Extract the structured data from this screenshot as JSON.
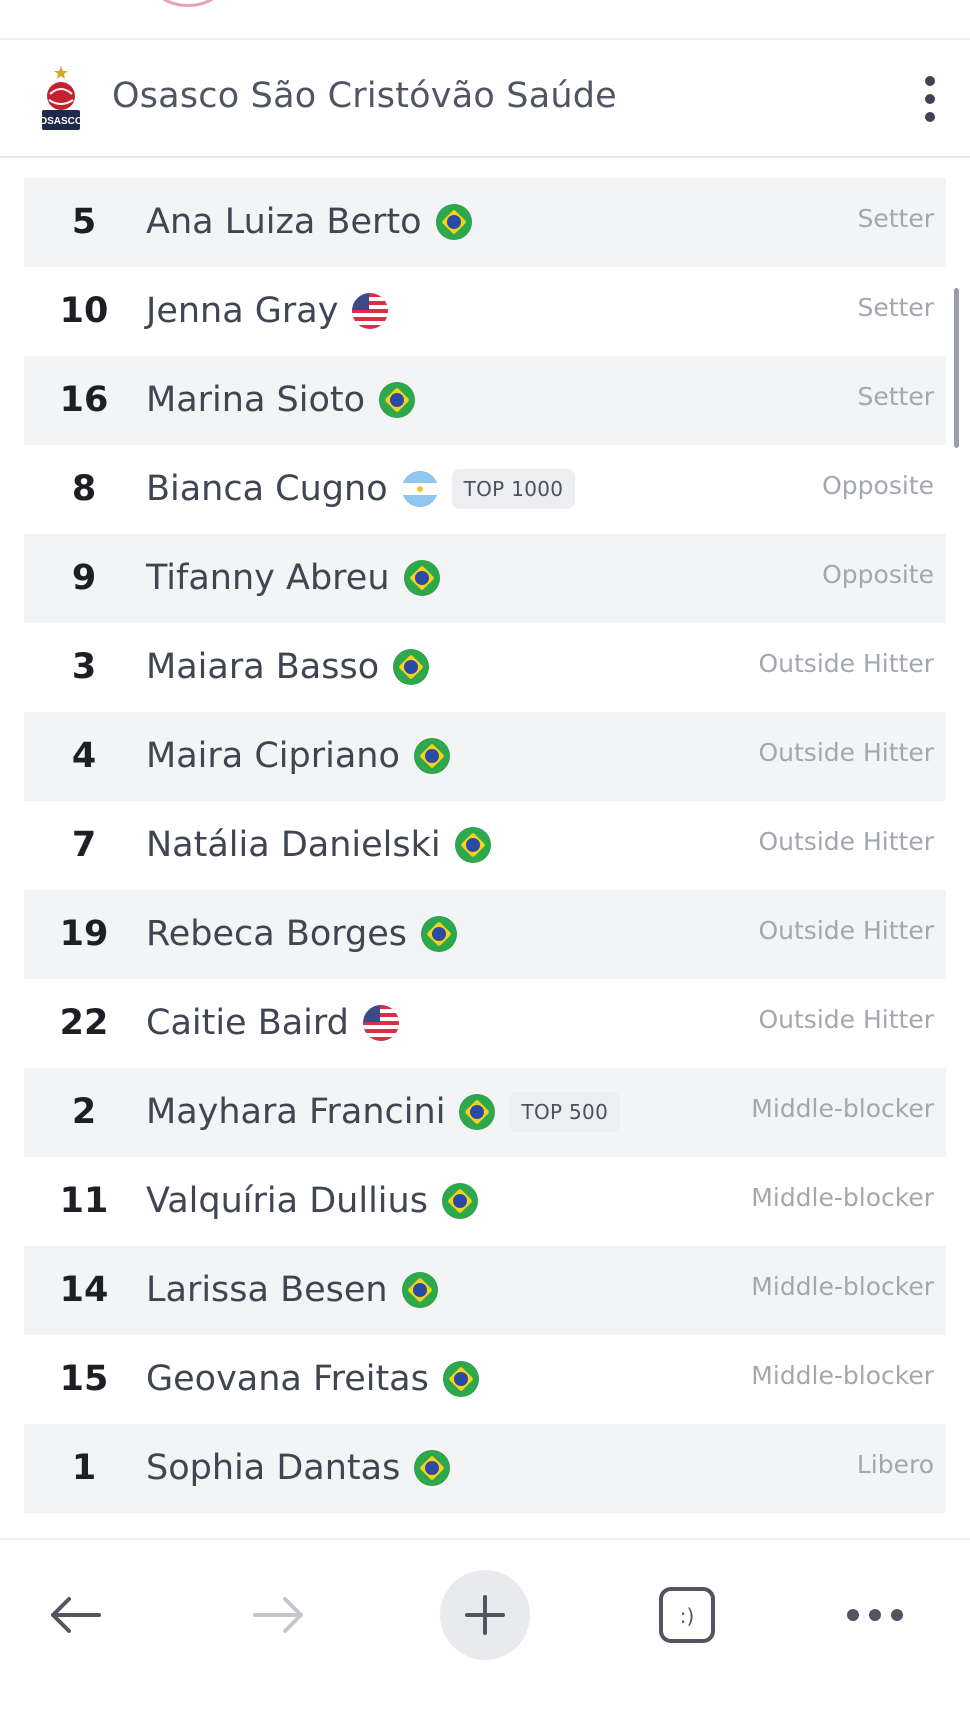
{
  "header": {
    "team_name": "Osasco São Cristóvão Saúde",
    "logo_text": "OSASCO"
  },
  "roster": [
    {
      "number": "5",
      "name": "Ana Luiza Berto",
      "flag": "br",
      "badge": "",
      "position": "Setter"
    },
    {
      "number": "10",
      "name": "Jenna Gray",
      "flag": "us",
      "badge": "",
      "position": "Setter"
    },
    {
      "number": "16",
      "name": "Marina Sioto",
      "flag": "br",
      "badge": "",
      "position": "Setter"
    },
    {
      "number": "8",
      "name": "Bianca Cugno",
      "flag": "ar",
      "badge": "TOP 1000",
      "position": "Opposite"
    },
    {
      "number": "9",
      "name": "Tifanny Abreu",
      "flag": "br",
      "badge": "",
      "position": "Opposite"
    },
    {
      "number": "3",
      "name": "Maiara Basso",
      "flag": "br",
      "badge": "",
      "position": "Outside Hitter"
    },
    {
      "number": "4",
      "name": "Maira Cipriano",
      "flag": "br",
      "badge": "",
      "position": "Outside Hitter"
    },
    {
      "number": "7",
      "name": "Natália Danielski",
      "flag": "br",
      "badge": "",
      "position": "Outside Hitter"
    },
    {
      "number": "19",
      "name": "Rebeca Borges",
      "flag": "br",
      "badge": "",
      "position": "Outside Hitter"
    },
    {
      "number": "22",
      "name": "Caitie Baird",
      "flag": "us",
      "badge": "",
      "position": "Outside Hitter"
    },
    {
      "number": "2",
      "name": "Mayhara Francini",
      "flag": "br",
      "badge": "TOP 500",
      "position": "Middle-blocker"
    },
    {
      "number": "11",
      "name": "Valquíria Dullius",
      "flag": "br",
      "badge": "",
      "position": "Middle-blocker"
    },
    {
      "number": "14",
      "name": "Larissa Besen",
      "flag": "br",
      "badge": "",
      "position": "Middle-blocker"
    },
    {
      "number": "15",
      "name": "Geovana Freitas",
      "flag": "br",
      "badge": "",
      "position": "Middle-blocker"
    },
    {
      "number": "1",
      "name": "Sophia Dantas",
      "flag": "br",
      "badge": "",
      "position": "Libero"
    }
  ],
  "bottom_nav": {
    "tabs_label": ":)"
  }
}
